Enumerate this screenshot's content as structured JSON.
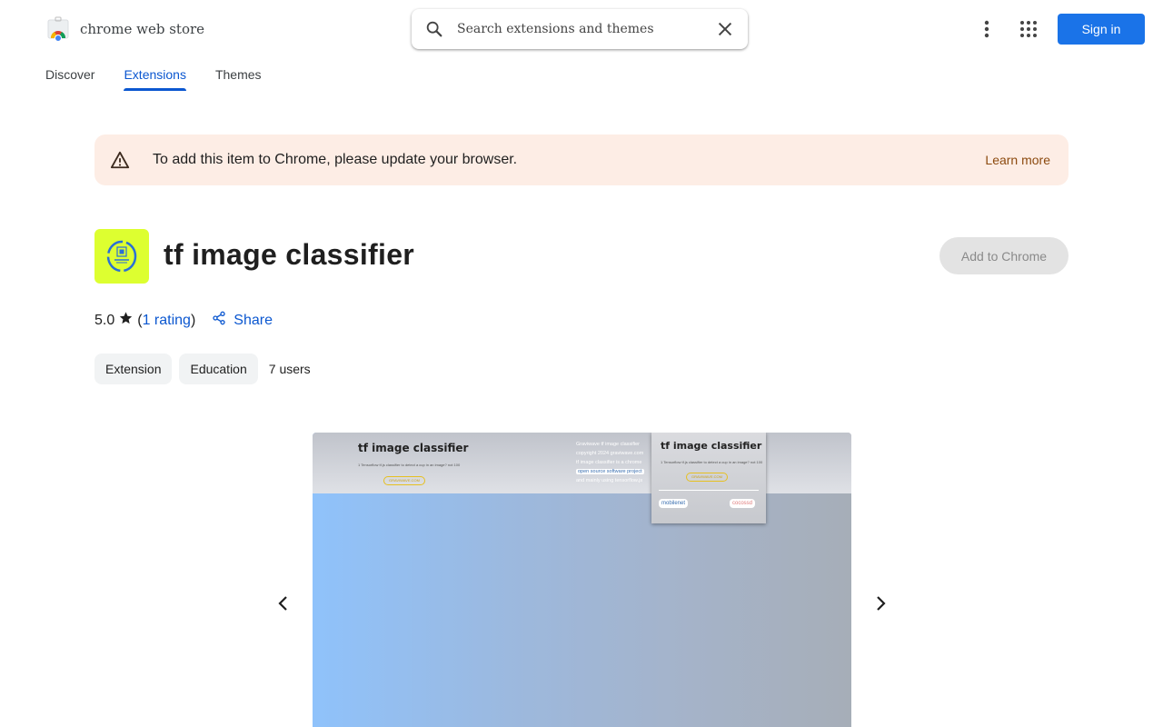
{
  "header": {
    "store_name": "chrome web store",
    "search_placeholder": "Search extensions and themes",
    "signin_label": "Sign in",
    "tabs": [
      {
        "label": "Discover"
      },
      {
        "label": "Extensions"
      },
      {
        "label": "Themes"
      }
    ],
    "active_tab": "Extensions"
  },
  "alert": {
    "message": "To add this item to Chrome, please update your browser.",
    "link_label": "Learn more"
  },
  "extension": {
    "title": "tf image classifier",
    "add_button_label": "Add to Chrome",
    "rating_value": "5.0",
    "rating_open": "(",
    "rating_count_label": "1 rating",
    "rating_close": ")",
    "share_label": "Share",
    "chips": [
      "Extension",
      "Education"
    ],
    "users": "7 users",
    "icon_bg_color": "#ddff30"
  },
  "screenshot": {
    "title": "tf image classifier",
    "subtitle": "1 Tensorflow tf.js classifier to detect a cup in an image? not 100",
    "pill_label": "GRAVIWAVE.COM",
    "notes": [
      "Graviwave tf image classifier",
      "copyright 2024 graviwave.com",
      "tf image classifier is a chrome",
      "open source software project",
      "and mainly using tensorflow.js"
    ],
    "popup_title": "tf image classifier",
    "popup_subtitle": "1 Tensorflow tf.js classifier to detect a cup in an image? not 100",
    "popup_pill_label": "GRAVIWAVE.COM",
    "popup_button_left": "mobilenet",
    "popup_button_right": "cocossd"
  },
  "colors": {
    "accent": "#0b57d0",
    "signin": "#1a73e8",
    "alert_bg": "#fdede5",
    "alert_link": "#8c4a0f"
  }
}
